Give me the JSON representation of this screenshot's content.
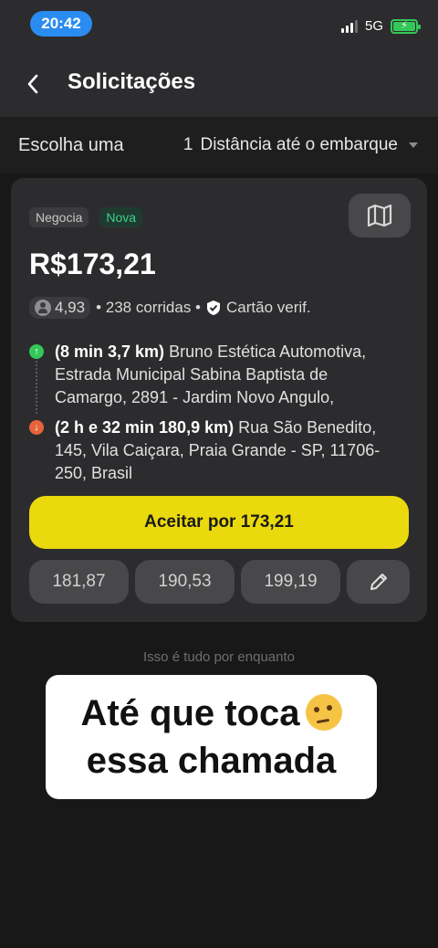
{
  "status_bar": {
    "time": "20:42",
    "network": "5G"
  },
  "header": {
    "title": "Solicitações"
  },
  "filter": {
    "left_label": "Escolha uma",
    "sort_number": "1",
    "sort_label": "Distância até o embarque"
  },
  "request": {
    "tag_negotiate": "Negocia",
    "tag_new": "Nova",
    "price": "R$173,21",
    "rating": "4,93",
    "rides": "• 238 corridas •",
    "card_verified": "Cartão verif.",
    "pickup_eta": "(8 min 3,7 km)",
    "pickup_address": "Bruno Estética Automotiva, Estrada Municipal Sabina Baptista de Camargo, 2891 - Jardim Novo Angulo,",
    "dropoff_eta": "(2 h e 32 min 180,9 km)",
    "dropoff_address": "Rua São Benedito, 145, Vila Caiçara, Praia Grande - SP, 11706-250, Brasil",
    "accept_label": "Aceitar por 173,21",
    "offers": [
      "181,87",
      "190,53",
      "199,19"
    ]
  },
  "footer_note": "Isso é tudo por enquanto",
  "overlay": {
    "line1": "Até que toca",
    "line2": "essa chamada"
  },
  "colors": {
    "accent_yellow": "#ead90c",
    "pickup_green": "#34c759",
    "dropoff_orange": "#e8633a",
    "new_green": "#3fcf87"
  }
}
